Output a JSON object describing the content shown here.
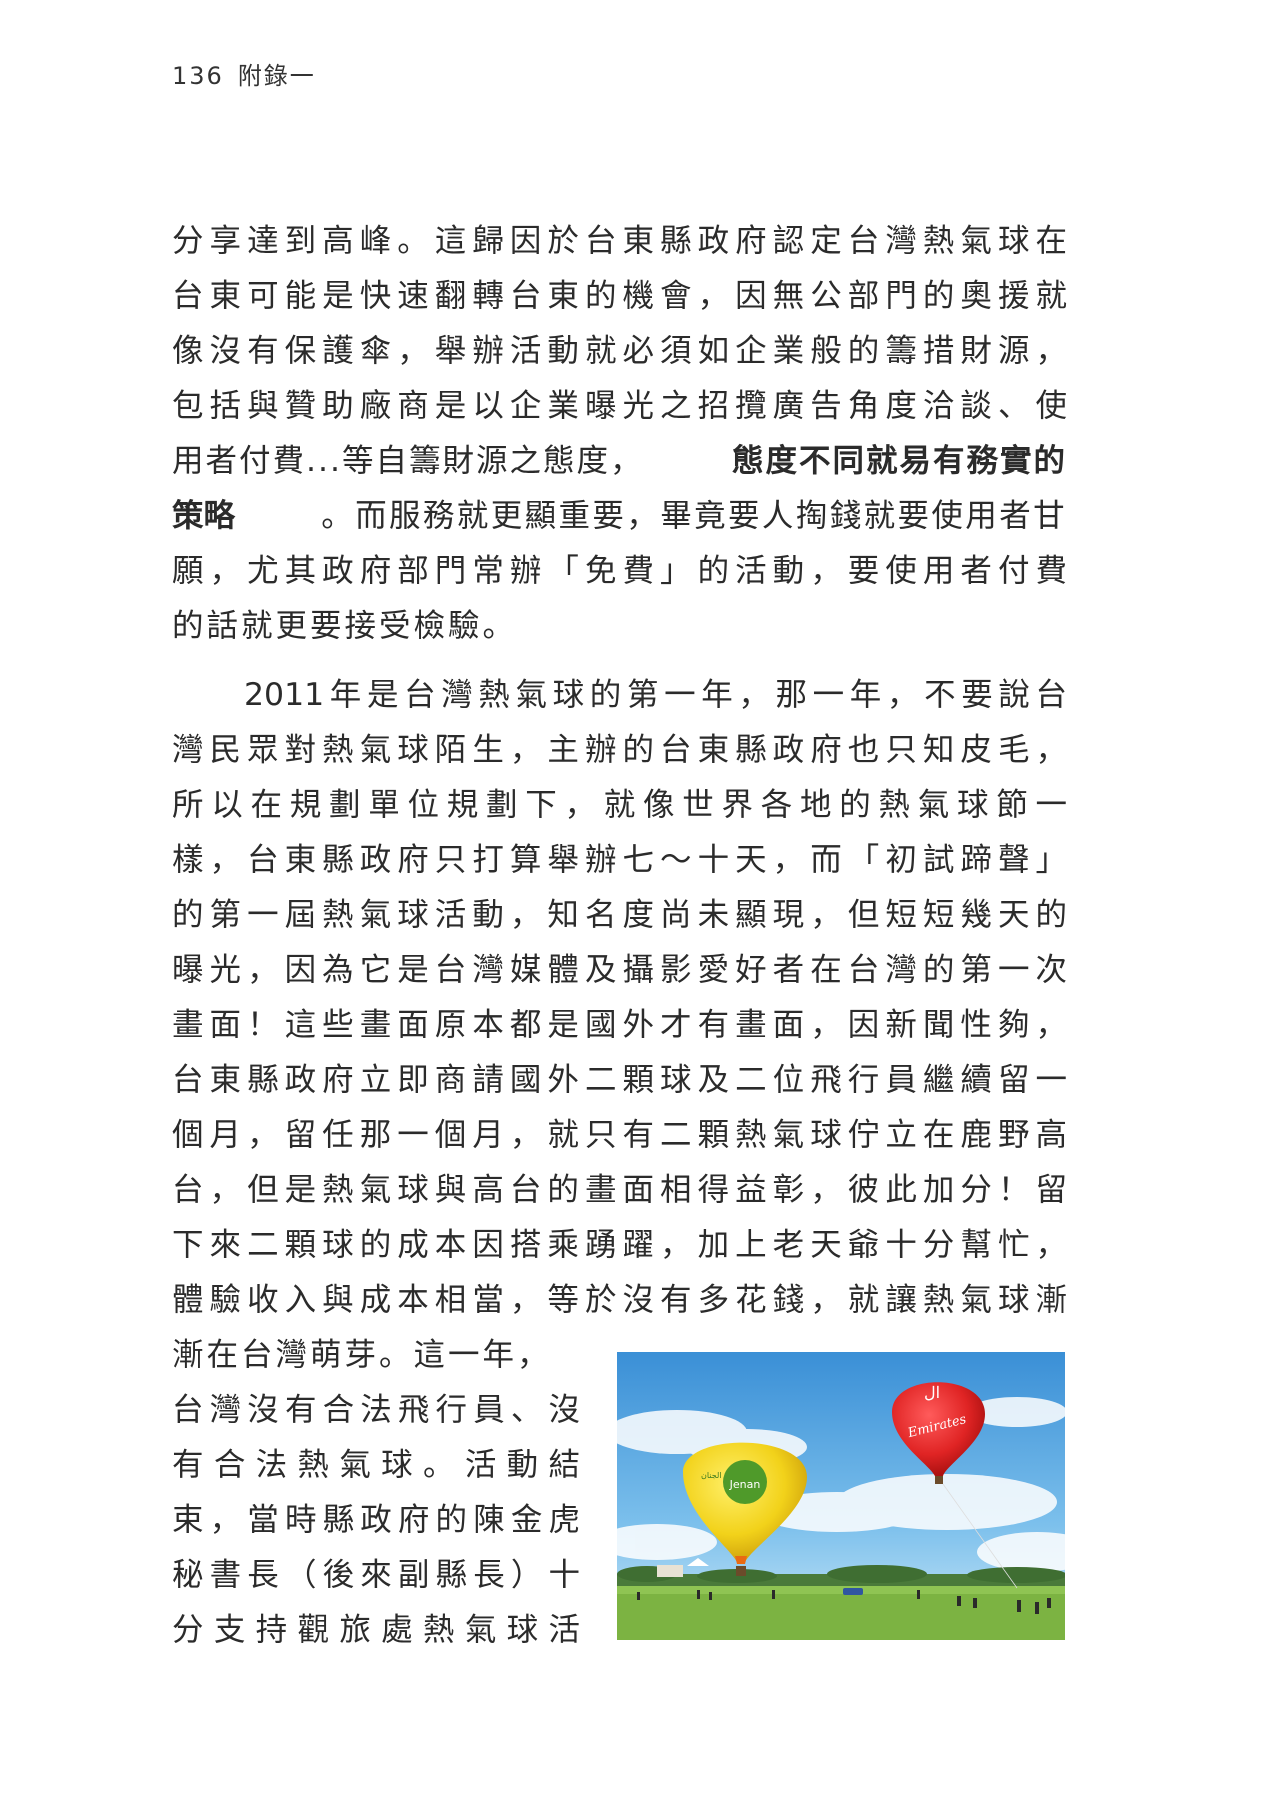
{
  "header": {
    "page_number": "136",
    "section": "附錄一"
  },
  "paragraph1": [
    "分享達到高峰。這歸因於台東縣政府認定台灣熱氣球在",
    "台東可能是快速翻轉台東的機會，因無公部門的奧援就",
    "像沒有保護傘，舉辦活動就必須如企業般的籌措財源，",
    "包括與贊助廠商是以企業曝光之招攬廣告角度洽談、使",
    "用者付費...等自籌財源之態度，",
    "態度不同就易有務實的",
    "策略",
    "。而服務就更顯重要，畢竟要人掏錢就要使用者甘",
    "願，尤其政府部門常辦「免費」的活動，要使用者付費",
    "的話就更要接受檢驗。"
  ],
  "paragraph2": [
    "2011年是台灣熱氣球的第一年，那一年，不要說台",
    "灣民眾對熱氣球陌生，主辦的台東縣政府也只知皮毛，",
    "所以在規劃單位規劃下，就像世界各地的熱氣球節一",
    "樣，台東縣政府只打算舉辦七～十天，而「初試蹄聲」",
    "的第一屆熱氣球活動，知名度尚未顯現，但短短幾天的",
    "曝光，因為它是台灣媒體及攝影愛好者在台灣的第一次",
    "畫面！這些畫面原本都是國外才有畫面，因新聞性夠，",
    "台東縣政府立即商請國外二顆球及二位飛行員繼續留一",
    "個月，留任那一個月，就只有二顆熱氣球佇立在鹿野高",
    "台，但是熱氣球與高台的畫面相得益彰，彼此加分！留",
    "下來二顆球的成本因搭乘踴躍，加上老天爺十分幫忙，",
    "體驗收入與成本相當，等於沒有多花錢，就讓熱氣球漸"
  ],
  "paragraph2_wrap": [
    "漸在台灣萌芽。這一年，",
    "台灣沒有合法飛行員、沒",
    "有合法熱氣球。活動結",
    "束，當時縣政府的陳金虎",
    "秘書長（後來副縣長）十",
    "分支持觀旅處熱氣球活"
  ],
  "photo": {
    "balloon_red_text": "Emirates",
    "balloon_yellow_text": "Jenan",
    "colors": {
      "sky": "#3f95d8",
      "grass": "#7cb342",
      "red_balloon": "#e02424",
      "yellow_balloon": "#f2d21a"
    }
  }
}
